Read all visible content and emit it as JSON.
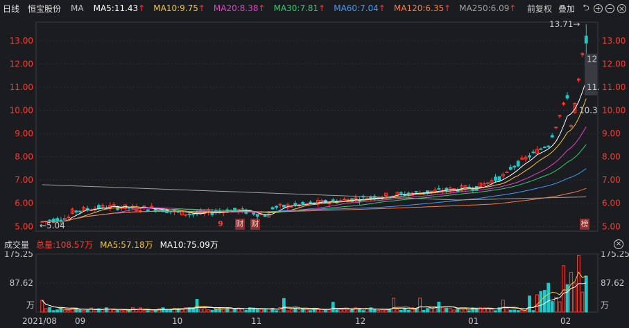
{
  "header": {
    "period": "日线",
    "stock_name": "恒宝股份",
    "indicator": "MA",
    "ma_items": [
      {
        "label": "MA5:11.43",
        "arrow": "↑",
        "color": "#ffffff"
      },
      {
        "label": "MA10:9.75",
        "arrow": "↑",
        "color": "#f5c43c"
      },
      {
        "label": "MA20:8.38",
        "arrow": "↑",
        "color": "#e040c8"
      },
      {
        "label": "MA30:7.81",
        "arrow": "↑",
        "color": "#2ecc71"
      },
      {
        "label": "MA60:7.04",
        "arrow": "↑",
        "color": "#3d9cff"
      },
      {
        "label": "MA120:6.35",
        "arrow": "↑",
        "color": "#ff7a3d"
      },
      {
        "label": "MA250:6.09",
        "arrow": "↑",
        "color": "#a0a0a0"
      }
    ],
    "arrow_color": "#ff3b30",
    "fuquan": "前复权",
    "overlay": "叠加"
  },
  "price_axis": {
    "ticks": [
      "13.00",
      "12.00",
      "11.00",
      "10.00",
      "9.00",
      "8.00",
      "7.00",
      "6.00",
      "5.00"
    ]
  },
  "annotations": {
    "high": "13.71→",
    "low": "←5.04",
    "right_tag_1": "12",
    "right_tag_2": "11.",
    "right_tag_3": "10.3"
  },
  "event_tags": [
    "9",
    "财",
    "财",
    "榜"
  ],
  "volume": {
    "title": "成交量",
    "total": "总量:108.57万",
    "ma5": "MA5:57.18万",
    "ma10": "MA10:75.09万",
    "ticks": [
      "175.25",
      "87.62",
      "万"
    ],
    "colors": {
      "total": "#ff3b30",
      "ma5": "#f5c43c",
      "ma10": "#ffffff"
    }
  },
  "xaxis": {
    "labels": [
      "2021/08",
      "09",
      "10",
      "11",
      "12",
      "01",
      "02"
    ]
  },
  "chart_data": {
    "type": "candlestick",
    "y_range": [
      4.8,
      13.8
    ],
    "vol_range": [
      0,
      175.25
    ],
    "high": 13.71,
    "low": 5.04,
    "ma_last": {
      "MA5": 11.43,
      "MA10": 9.75,
      "MA20": 8.38,
      "MA30": 7.81,
      "MA60": 7.04,
      "MA120": 6.35,
      "MA250": 6.09
    },
    "volume_total": 108.57,
    "volume_ma5": 57.18,
    "volume_ma10": 75.09
  },
  "colors": {
    "up": "#ff3b30",
    "down": "#1fc7c7",
    "grid": "#2e2f35",
    "axis_text": "#ff3b30"
  }
}
